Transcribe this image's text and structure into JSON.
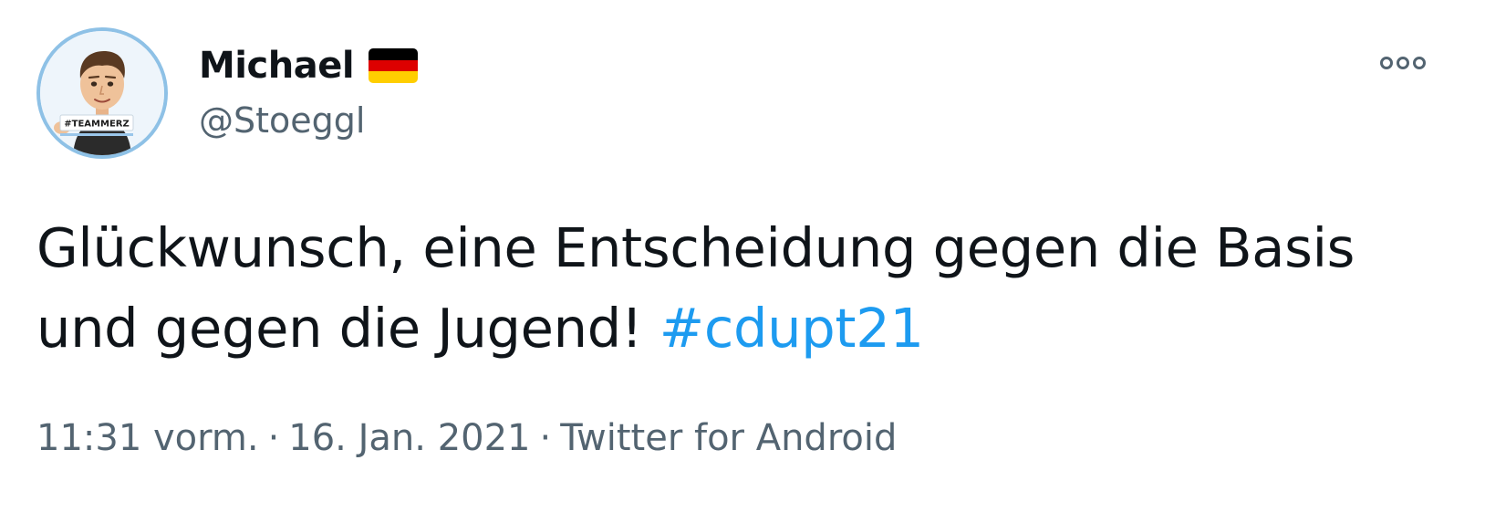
{
  "author": {
    "display_name": "Michael",
    "handle": "@Stoeggl",
    "avatar_badge_text": "#TEAMMERZ",
    "flag_colors": [
      "#000000",
      "#dd0000",
      "#ffce00"
    ]
  },
  "tweet": {
    "text_main": "Glückwunsch, eine Entscheidung gegen die Basis und gegen die Jugend! ",
    "hashtag": "#cdupt21"
  },
  "meta": {
    "time": "11:31 vorm.",
    "separator": "·",
    "date": "16. Jan. 2021",
    "source": "Twitter for Android"
  },
  "colors": {
    "accent": "#1d9bf0",
    "secondary_text": "#536471",
    "primary_text": "#0f1419",
    "avatar_border": "#8ec1e6"
  },
  "icons": {
    "more": "more-horizontal-icon"
  }
}
